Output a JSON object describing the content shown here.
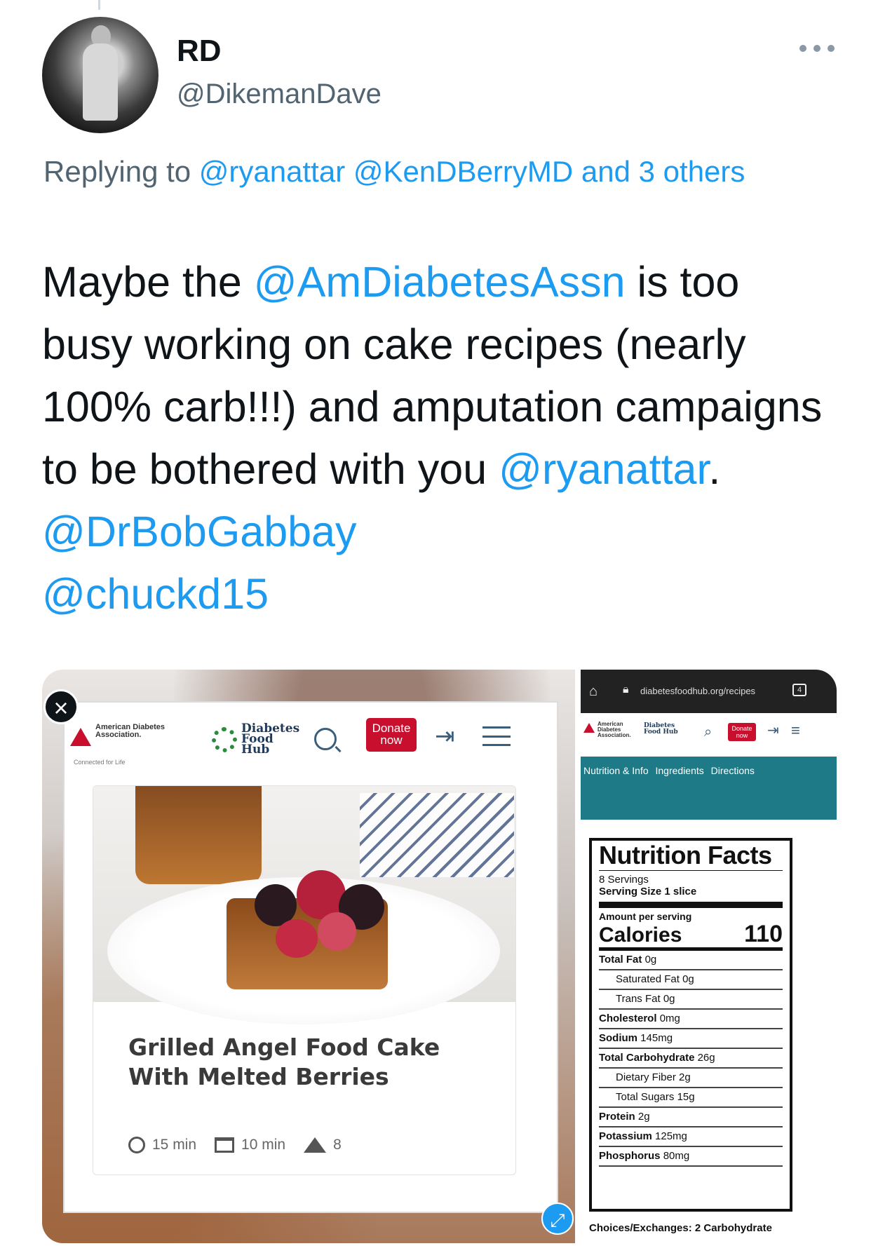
{
  "tweet": {
    "display_name": "RD",
    "handle": "@DikemanDave",
    "reply_prefix": "Replying to",
    "reply_mentions": [
      "@ryanattar",
      "@KenDBerryMD",
      "and 3 others"
    ],
    "text_parts": [
      {
        "t": "Maybe the ",
        "link": false
      },
      {
        "t": "@AmDiabetesAssn",
        "link": true
      },
      {
        "t": " is too busy working on cake recipes (nearly 100% carb!!!) and amputation campaigns to be bothered with you ",
        "link": false
      },
      {
        "t": "@ryanattar",
        "link": true
      },
      {
        "t": ". ",
        "link": false
      },
      {
        "t": "@DrBobGabbay",
        "link": true
      },
      {
        "t": " ",
        "link": false
      },
      {
        "t": "@chuckd15",
        "link": true
      }
    ]
  },
  "colors": {
    "link": "#1d9bf0",
    "muted": "#536471",
    "ada_red": "#c8102e",
    "teal": "#1e7a86"
  },
  "left_image": {
    "ada_logo": "American Diabetes Association.",
    "ada_tagline": "Connected for Life",
    "dfh_logo": "Diabetes Food Hub",
    "donate": "Donate now",
    "recipe_title": "Grilled Angel Food Cake With Melted Berries",
    "prep_time": "15 min",
    "cook_time": "10 min",
    "servings": "8"
  },
  "right_image": {
    "url": "diabetesfoodhub.org/recipes",
    "tab_count": "4",
    "tabs": [
      "Nutrition & Info",
      "Ingredients",
      "Directions"
    ],
    "nutrition": {
      "title": "Nutrition Facts",
      "servings": "8 Servings",
      "serving_size_label": "Serving Size",
      "serving_size": "1 slice",
      "amount_per_serving": "Amount per serving",
      "calories_label": "Calories",
      "calories": "110",
      "rows": [
        {
          "label": "Total Fat",
          "value": "0g",
          "indent": false
        },
        {
          "label": "Saturated Fat",
          "value": "0g",
          "indent": true
        },
        {
          "label": "Trans Fat",
          "value": "0g",
          "indent": true
        },
        {
          "label": "Cholesterol",
          "value": "0mg",
          "indent": false
        },
        {
          "label": "Sodium",
          "value": "145mg",
          "indent": false
        },
        {
          "label": "Total Carbohydrate",
          "value": "26g",
          "indent": false
        },
        {
          "label": "Dietary Fiber",
          "value": "2g",
          "indent": true
        },
        {
          "label": "Total Sugars",
          "value": "15g",
          "indent": true
        },
        {
          "label": "Protein",
          "value": "2g",
          "indent": false
        },
        {
          "label": "Potassium",
          "value": "125mg",
          "indent": false
        },
        {
          "label": "Phosphorus",
          "value": "80mg",
          "indent": false
        }
      ]
    },
    "choices": "Choices/Exchanges: 2 Carbohydrate"
  }
}
